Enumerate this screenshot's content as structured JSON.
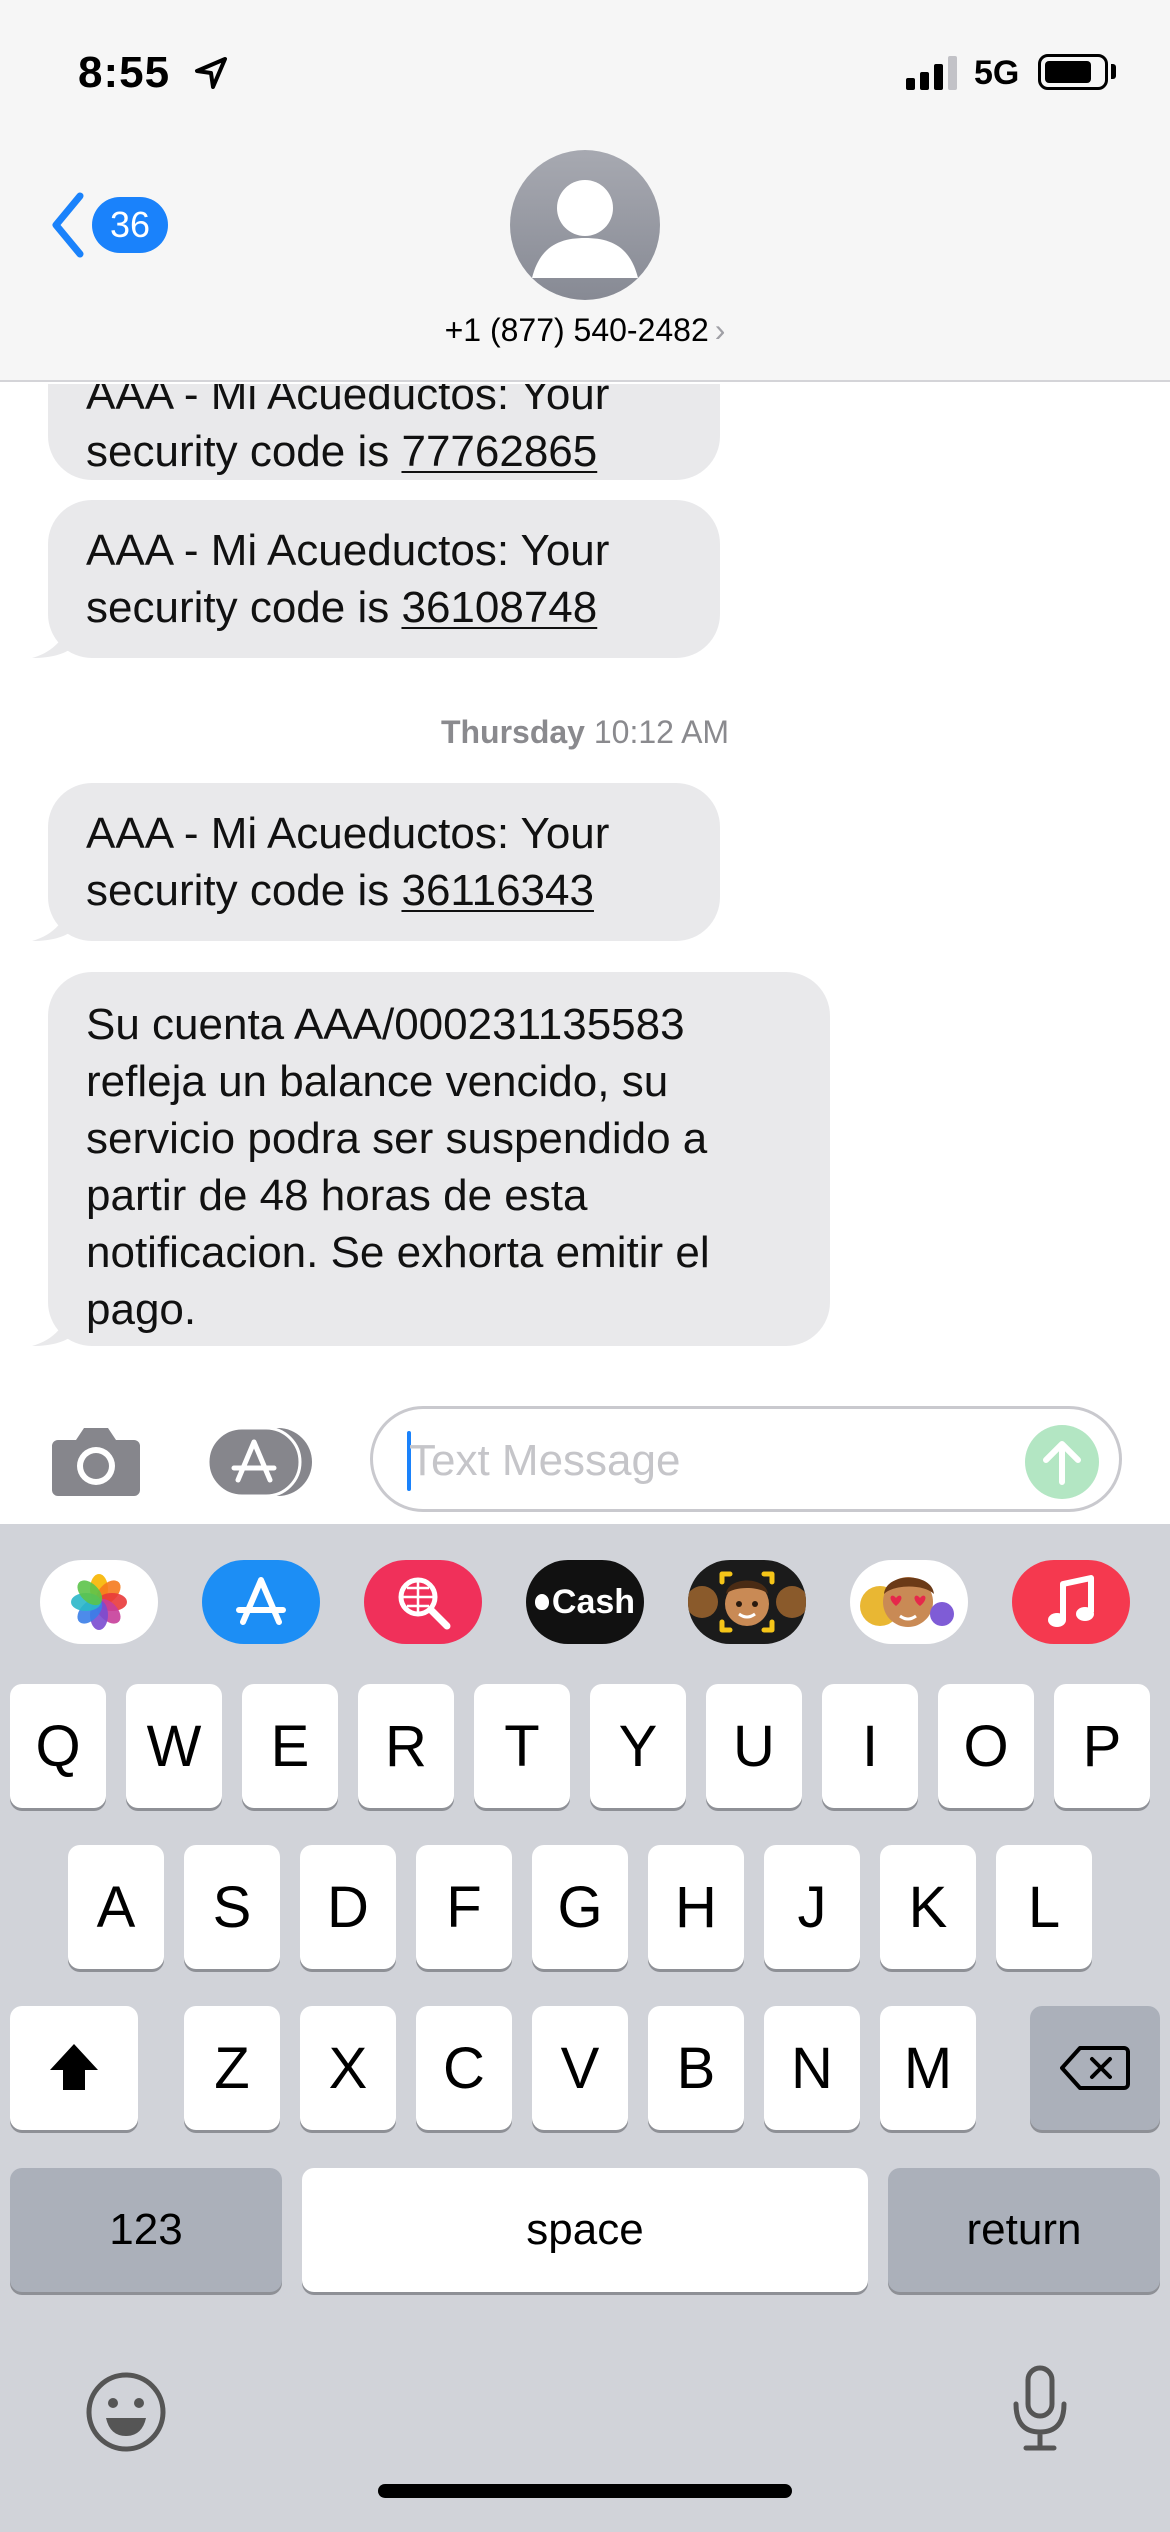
{
  "status_bar": {
    "time": "8:55",
    "network": "5G",
    "signal_bars_active": 3,
    "signal_bars_total": 4
  },
  "header": {
    "back_count": "36",
    "contact": "+1 (877) 540-2482",
    "contact_chevron": "›"
  },
  "thread": {
    "messages_before": [
      {
        "prefix": "AAA - Mi Acueductos: Your security code is ",
        "code": "77762865"
      },
      {
        "prefix": "AAA - Mi Acueductos: Your security code is ",
        "code": "36108748"
      }
    ],
    "timestamp_day": "Thursday",
    "timestamp_time": "10:12 AM",
    "messages_after": [
      {
        "prefix": "AAA - Mi Acueductos: Your security code is ",
        "code": "36116343"
      },
      {
        "text": "Su cuenta AAA/000231135583 refleja un balance vencido, su servicio podra ser suspendido a partir de 48 horas de esta notificacion. Se exhorta emitir el pago."
      }
    ]
  },
  "input": {
    "placeholder": "Text Message"
  },
  "app_strip": [
    {
      "name": "photos-app-icon",
      "bg": "#ffffff"
    },
    {
      "name": "app-store-icon",
      "bg": "#1c8ef5"
    },
    {
      "name": "image-search-icon",
      "bg": "#f0305a"
    },
    {
      "name": "apple-cash-icon",
      "bg": "#111111",
      "label": "Cash"
    },
    {
      "name": "memoji-icon",
      "bg": "#1b1b1b"
    },
    {
      "name": "memoji-stickers-icon",
      "bg": "#ffffff"
    },
    {
      "name": "music-icon",
      "bg": "#f5394f"
    }
  ],
  "keyboard": {
    "row1": [
      "Q",
      "W",
      "E",
      "R",
      "T",
      "Y",
      "U",
      "I",
      "O",
      "P"
    ],
    "row2": [
      "A",
      "S",
      "D",
      "F",
      "G",
      "H",
      "J",
      "K",
      "L"
    ],
    "row3": [
      "Z",
      "X",
      "C",
      "V",
      "B",
      "N",
      "M"
    ],
    "numbers_label": "123",
    "space_label": "space",
    "return_label": "return"
  },
  "colors": {
    "accent": "#1a82fb",
    "bubble": "#e9e9eb",
    "keyboard_bg": "#d1d3d9",
    "send_disabled": "#b3e6c3"
  }
}
